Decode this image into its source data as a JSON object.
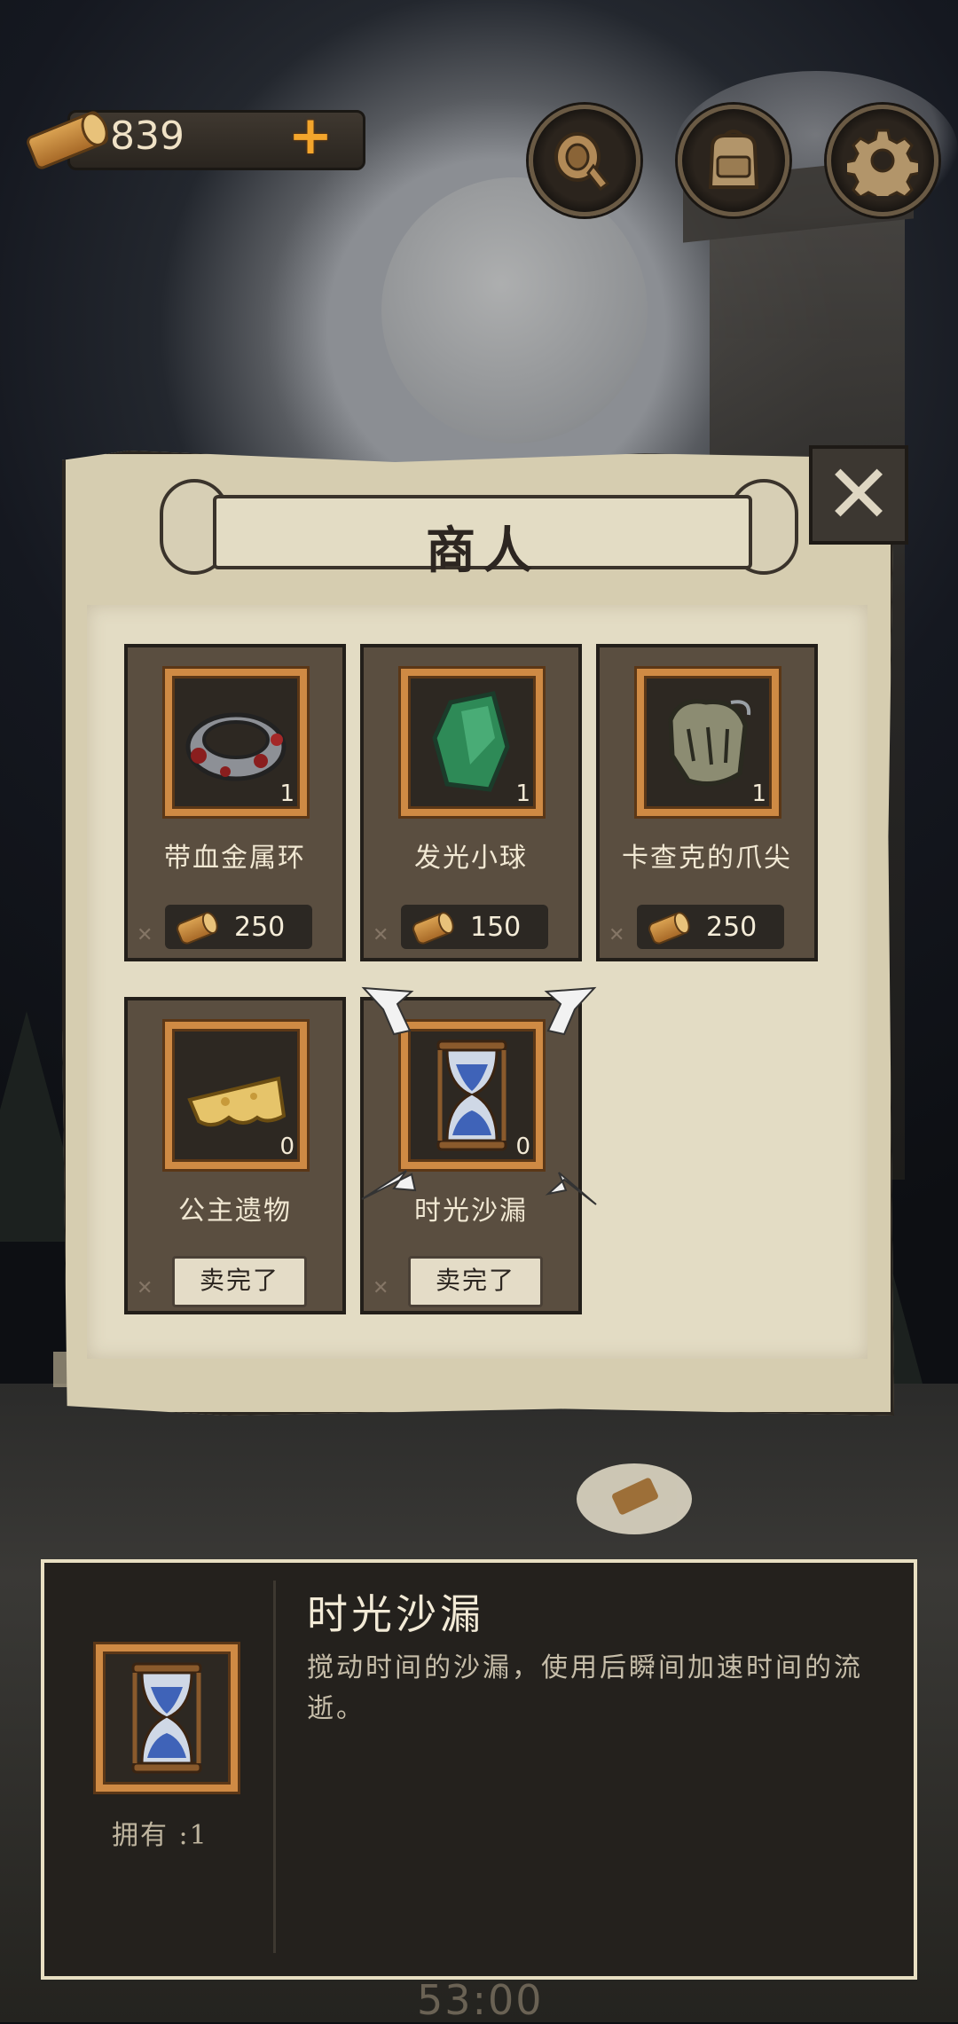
{
  "top_bar": {
    "currency": {
      "value": "839",
      "add_symbol": "+"
    },
    "buttons": [
      {
        "icon": "horn-icon"
      },
      {
        "icon": "backpack-icon"
      },
      {
        "icon": "gear-icon"
      }
    ]
  },
  "merchant": {
    "title": "商人",
    "close_symbol": "✕",
    "items": [
      {
        "name": "带血金属环",
        "count": "1",
        "price": "250",
        "status": "price"
      },
      {
        "name": "发光小球",
        "count": "1",
        "price": "150",
        "status": "price"
      },
      {
        "name": "卡查克的爪尖",
        "count": "1",
        "price": "250",
        "status": "price"
      },
      {
        "name": "公主遗物",
        "count": "0",
        "status": "sold",
        "sold_label": "卖完了"
      },
      {
        "name": "时光沙漏",
        "count": "0",
        "status": "sold",
        "sold_label": "卖完了",
        "selected": true
      }
    ]
  },
  "detail": {
    "title": "时光沙漏",
    "description": "搅动时间的沙漏，使用后瞬间加速时间的流逝。",
    "owned": "拥有 :1"
  },
  "timer": "53:00",
  "colors": {
    "accent": "#cf8a44",
    "panel": "#d6cdb0",
    "card": "#5a4e40",
    "plus": "#f3a52c"
  }
}
